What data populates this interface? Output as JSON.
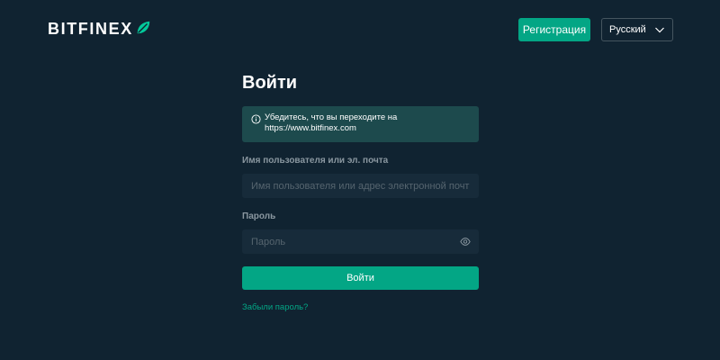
{
  "header": {
    "logo_text": "BITFINEX",
    "register_label": "Регистрация",
    "language": "Русский"
  },
  "login": {
    "title": "Войти",
    "notice_line1": "Убедитесь, что вы переходите на",
    "notice_line2": "https://www.bitfinex.com",
    "username_label": "Имя пользователя или эл. почта",
    "username_placeholder": "Имя пользователя или адрес электронной почты",
    "username_value": "",
    "password_label": "Пароль",
    "password_placeholder": "Пароль",
    "password_value": "",
    "submit_label": "Войти",
    "forgot_label": "Забыли пароль?"
  },
  "icons": {
    "logo": "leaf-icon",
    "language_dropdown": "chevron-down-icon",
    "notice": "info-icon",
    "password_toggle": "eye-icon"
  },
  "colors": {
    "background": "#102331",
    "accent": "#03a685",
    "notice_bg": "#1d4a4d",
    "input_bg": "#172b3a"
  }
}
